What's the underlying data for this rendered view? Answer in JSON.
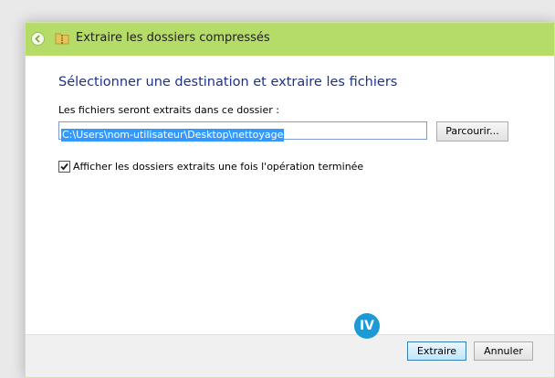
{
  "window": {
    "title": "Extraire les dossiers compressés",
    "accent_color": "#b5dc69",
    "back_icon": "back-arrow-icon",
    "title_icon": "compressed-folder-icon"
  },
  "main": {
    "heading": "Sélectionner une destination et extraire les fichiers",
    "destination_label": "Les fichiers seront extraits dans ce dossier :",
    "destination_value": "C:\\Users\\nom-utilisateur\\Desktop\\nettoyage",
    "browse_label": "Parcourir...",
    "show_files_checkbox": {
      "checked": true,
      "label": "Afficher les dossiers extraits une fois l'opération terminée"
    }
  },
  "footer": {
    "step_badge": "IV",
    "extract_label": "Extraire",
    "cancel_label": "Annuler"
  }
}
